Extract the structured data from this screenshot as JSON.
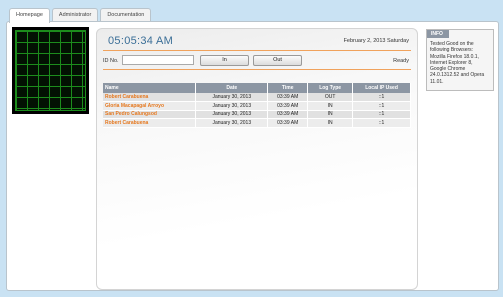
{
  "tabs": [
    {
      "label": "Homepage",
      "active": true
    },
    {
      "label": "Administrator",
      "active": false
    },
    {
      "label": "Documentation",
      "active": false
    }
  ],
  "clock": {
    "time": "05:05:34 AM",
    "date": "February 2, 2013 Saturday"
  },
  "form": {
    "id_label": "ID No.",
    "id_value": "",
    "in_label": "In",
    "out_label": "Out",
    "status": "Ready"
  },
  "table": {
    "headers": [
      "Name",
      "Date",
      "Time",
      "Log Type",
      "Local IP Used"
    ],
    "rows": [
      [
        "Robert Carabuena",
        "January 30, 2013",
        "03:39 AM",
        "OUT",
        "::1"
      ],
      [
        "Gloria Macapagal Arroyo",
        "January 30, 2013",
        "03:39 AM",
        "IN",
        "::1"
      ],
      [
        "San Pedro Calungsod",
        "January 30, 2013",
        "03:39 AM",
        "IN",
        "::1"
      ],
      [
        "Robert Carabuena",
        "January 30, 2013",
        "03:39 AM",
        "IN",
        "::1"
      ]
    ]
  },
  "info": {
    "title": "INFO",
    "text": "Tested Good on the following Browsers: Mozilla Firefox 18.0.1, Internet Explorer 8, Google Chrome 24.0.1312.52 and Opera 11.01."
  },
  "colors": {
    "accent": "#3a6e97",
    "rule": "#f0a25c",
    "name_text": "#e5781f",
    "header_bg": "#8c96a3"
  },
  "icons": {
    "grid": "green-grid-display"
  }
}
